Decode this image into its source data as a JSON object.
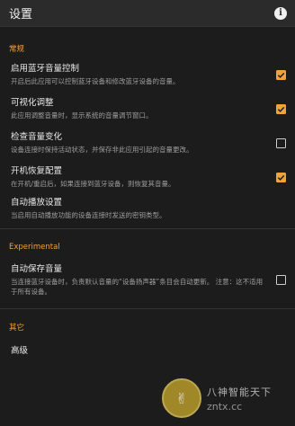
{
  "app": {
    "title": "设置"
  },
  "sections": [
    {
      "header": "常规",
      "prefs": [
        {
          "title": "启用蓝牙音量控制",
          "summary": "开启后此应用可以控制蓝牙设备和修改蓝牙设备的音量。",
          "checked": true
        },
        {
          "title": "可视化调整",
          "summary": "此应用调整音量时，显示系统的音量调节窗口。",
          "checked": true
        },
        {
          "title": "检查音量变化",
          "summary": "设备连接时保持活动状态，并保存非此应用引起的音量更改。",
          "checked": false
        },
        {
          "title": "开机恢复配置",
          "summary": "在开机/重启后，如果连接到蓝牙设备，则恢复其音量。",
          "checked": true
        },
        {
          "title": "自动播放设置",
          "summary": "当启用自动播放功能的设备连接时发送的密钥类型。",
          "checked": null
        }
      ]
    },
    {
      "header": "Experimental",
      "prefs": [
        {
          "title": "自动保存音量",
          "summary": "当连接蓝牙设备时，负责默认音量的“设备扬声器”条目会自动更新。 注意：这不适用于所有设备。",
          "checked": false
        }
      ]
    },
    {
      "header": "其它",
      "prefs": [
        {
          "title": "高级",
          "summary": "",
          "checked": null
        }
      ]
    }
  ],
  "watermark": {
    "line1": "八神智能天下",
    "line2": "zntx.cc"
  },
  "colors": {
    "accent": "#f2a23a",
    "background": "#1c1c1c",
    "appbar": "#2b2b2b"
  }
}
